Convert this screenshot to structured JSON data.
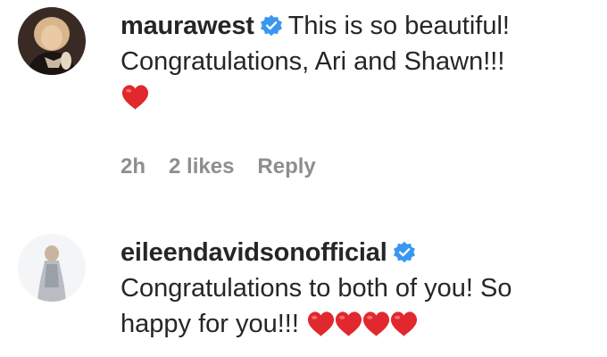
{
  "comments": [
    {
      "username": "maurawest",
      "verified": true,
      "text_line1": "This is so beautiful!",
      "text_line2": "Congratulations, Ari and Shawn!!!",
      "emoji": [
        "red-heart"
      ],
      "time": "2h",
      "likes": "2 likes",
      "reply_label": "Reply"
    },
    {
      "username": "eileendavidsonofficial",
      "verified": true,
      "text_line1": "Congratulations to both of you! So",
      "text_line2": "happy for you!!!",
      "emoji": [
        "red-heart",
        "red-heart",
        "red-heart",
        "red-heart"
      ]
    }
  ],
  "colors": {
    "text": "#262626",
    "meta": "#8e8e8e",
    "verified_badge": "#3897f0",
    "heart": "#e0282e"
  }
}
